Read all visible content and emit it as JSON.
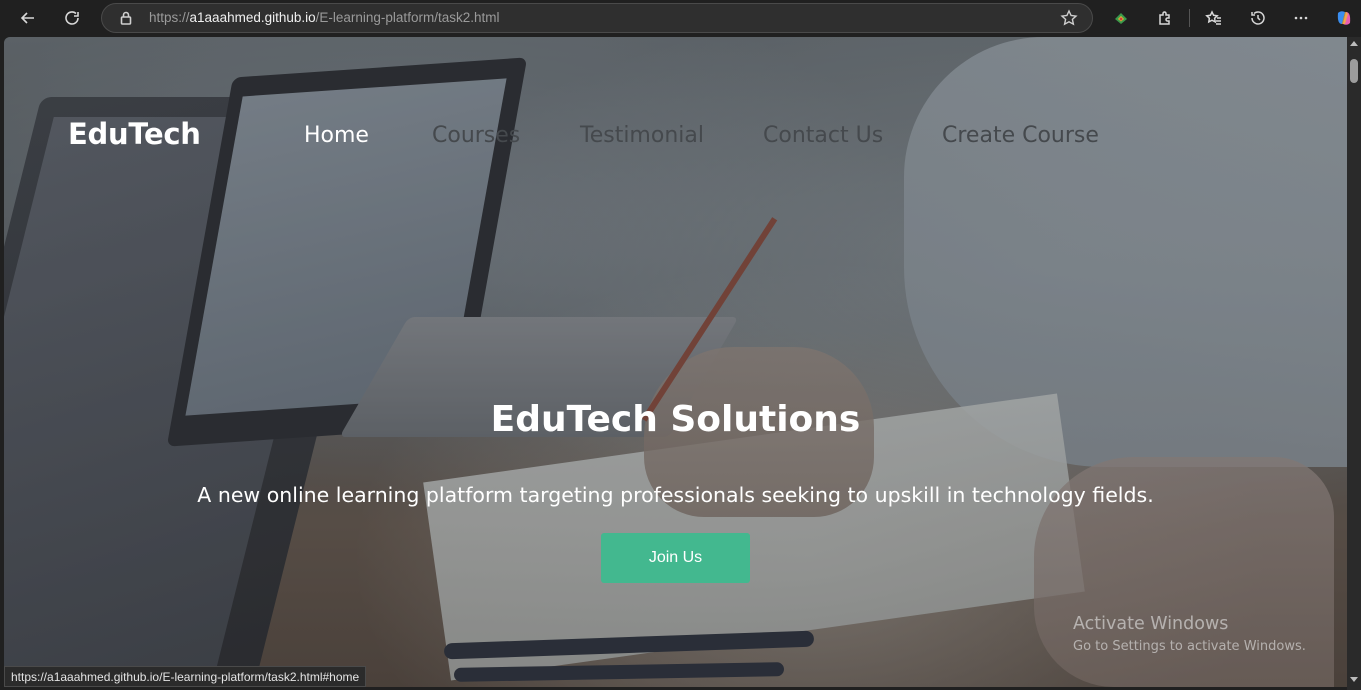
{
  "browser": {
    "url_prefix": "https://",
    "url_host": "a1aaahmed.github.io",
    "url_path": "/E-learning-platform/task2.html",
    "icons": [
      "back-icon",
      "refresh-icon",
      "lock-icon",
      "star-icon",
      "extension-colorful-icon",
      "puzzle-icon",
      "favorites-icon",
      "history-icon",
      "more-icon",
      "copilot-icon"
    ]
  },
  "nav": {
    "logo": "EduTech",
    "links": [
      {
        "label": "Home",
        "active": true
      },
      {
        "label": "Courses",
        "active": false
      },
      {
        "label": "Testimonial",
        "active": false
      },
      {
        "label": "Contact Us",
        "active": false
      },
      {
        "label": "Create Course",
        "active": false
      }
    ]
  },
  "hero": {
    "title": "EduTech Solutions",
    "subtitle": "A new online learning platform targeting professionals seeking to upskill in technology fields.",
    "cta_label": "Join Us",
    "cta_color": "#43b88f"
  },
  "watermark": {
    "title": "Activate Windows",
    "subtitle": "Go to Settings to activate Windows."
  },
  "status_bar": {
    "link_preview": "https://a1aaahmed.github.io/E-learning-platform/task2.html#home"
  }
}
